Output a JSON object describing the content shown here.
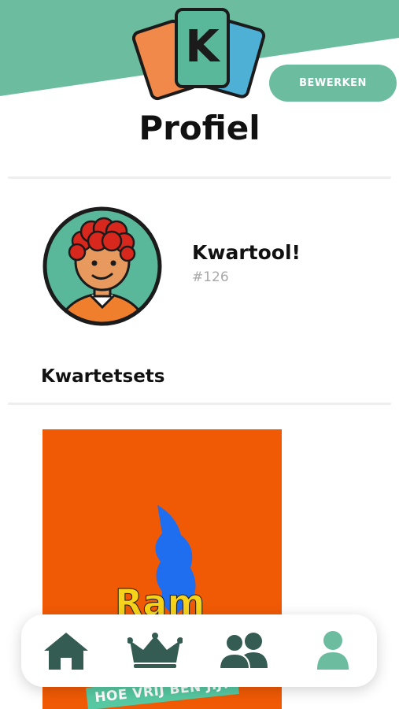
{
  "colors": {
    "accent": "#6cbd9f",
    "nav_inactive": "#345c52",
    "nav_active": "#6cbd9f",
    "set_card_bg": "#f15a05"
  },
  "header": {
    "logo_icon": "k-cards-logo-icon",
    "logo_letter": "K",
    "edit_label": "BEWERKEN",
    "title": "Profiel"
  },
  "profile": {
    "avatar_icon": "avatar",
    "name": "Kwartool!",
    "id": "#126"
  },
  "sets": {
    "title": "Kwartetsets",
    "items": [
      {
        "logo_text": "Ram",
        "tagline": "HOE VRIJ BEN JIJ?"
      }
    ]
  },
  "bottom_nav": {
    "items": [
      {
        "icon": "home-icon",
        "active": false
      },
      {
        "icon": "crown-icon",
        "active": false
      },
      {
        "icon": "group-icon",
        "active": false
      },
      {
        "icon": "user-icon",
        "active": true
      }
    ]
  }
}
